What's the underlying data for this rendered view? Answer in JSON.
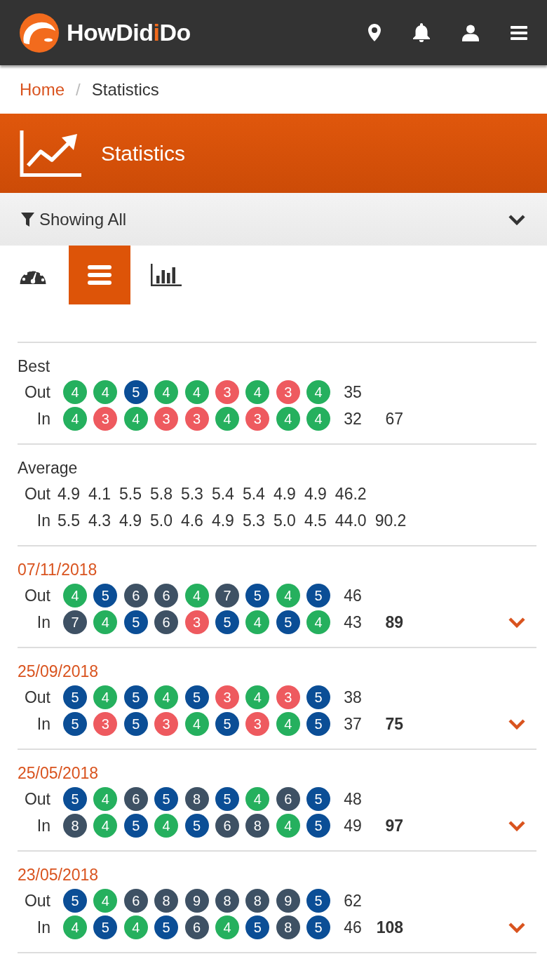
{
  "header": {
    "logo": [
      {
        "text": "HowDid",
        "accent": false
      },
      {
        "text": "i",
        "accent": true
      },
      {
        "text": "Do",
        "accent": false
      }
    ]
  },
  "breadcrumb": {
    "separator": "/",
    "items": [
      {
        "label": "Home",
        "current": false
      },
      {
        "label": "Statistics",
        "current": true
      }
    ]
  },
  "banner": {
    "title": "Statistics"
  },
  "filter": {
    "label": "Showing All",
    "expanded": false
  },
  "view_tabs": [
    {
      "kind": "gauge",
      "selected": false
    },
    {
      "kind": "list",
      "selected": true
    },
    {
      "kind": "chart",
      "selected": false
    }
  ],
  "best": {
    "title": "Best",
    "rows": [
      {
        "label": "Out",
        "holes": [
          {
            "score": "4",
            "color": "#25b05e"
          },
          {
            "score": "4",
            "color": "#25b05e"
          },
          {
            "score": "5",
            "color": "#0b4e96"
          },
          {
            "score": "4",
            "color": "#25b05e"
          },
          {
            "score": "4",
            "color": "#25b05e"
          },
          {
            "score": "3",
            "color": "#ee5a5f"
          },
          {
            "score": "4",
            "color": "#25b05e"
          },
          {
            "score": "3",
            "color": "#ee5a5f"
          },
          {
            "score": "4",
            "color": "#25b05e"
          }
        ],
        "total": "35"
      },
      {
        "label": "In",
        "holes": [
          {
            "score": "4",
            "color": "#25b05e"
          },
          {
            "score": "3",
            "color": "#ee5a5f"
          },
          {
            "score": "4",
            "color": "#25b05e"
          },
          {
            "score": "3",
            "color": "#ee5a5f"
          },
          {
            "score": "3",
            "color": "#ee5a5f"
          },
          {
            "score": "4",
            "color": "#25b05e"
          },
          {
            "score": "3",
            "color": "#ee5a5f"
          },
          {
            "score": "4",
            "color": "#25b05e"
          },
          {
            "score": "4",
            "color": "#25b05e"
          }
        ],
        "total": "32",
        "gross": "67"
      }
    ]
  },
  "average": {
    "title": "Average",
    "rows": [
      {
        "label": "Out",
        "values": [
          "4.9",
          "4.1",
          "5.5",
          "5.8",
          "5.3",
          "5.4",
          "5.4",
          "4.9",
          "4.9"
        ],
        "total": "46.2"
      },
      {
        "label": "In",
        "values": [
          "5.5",
          "4.3",
          "4.9",
          "5.0",
          "4.6",
          "4.9",
          "5.3",
          "5.0",
          "4.5"
        ],
        "total": "44.0",
        "gross": "90.2"
      }
    ]
  },
  "rounds": [
    {
      "date": "07/11/2018",
      "expanded": false,
      "rows": [
        {
          "label": "Out",
          "holes": [
            {
              "score": "4",
              "color": "#25b05e"
            },
            {
              "score": "5",
              "color": "#0b4e96"
            },
            {
              "score": "6",
              "color": "#3e5164"
            },
            {
              "score": "6",
              "color": "#3e5164"
            },
            {
              "score": "4",
              "color": "#25b05e"
            },
            {
              "score": "7",
              "color": "#3e5164"
            },
            {
              "score": "5",
              "color": "#0b4e96"
            },
            {
              "score": "4",
              "color": "#25b05e"
            },
            {
              "score": "5",
              "color": "#0b4e96"
            }
          ],
          "total": "46"
        },
        {
          "label": "In",
          "holes": [
            {
              "score": "7",
              "color": "#3e5164"
            },
            {
              "score": "4",
              "color": "#25b05e"
            },
            {
              "score": "5",
              "color": "#0b4e96"
            },
            {
              "score": "6",
              "color": "#3e5164"
            },
            {
              "score": "3",
              "color": "#ee5a5f"
            },
            {
              "score": "5",
              "color": "#0b4e96"
            },
            {
              "score": "4",
              "color": "#25b05e"
            },
            {
              "score": "5",
              "color": "#0b4e96"
            },
            {
              "score": "4",
              "color": "#25b05e"
            }
          ],
          "total": "43",
          "gross": "89"
        }
      ]
    },
    {
      "date": "25/09/2018",
      "expanded": false,
      "rows": [
        {
          "label": "Out",
          "holes": [
            {
              "score": "5",
              "color": "#0b4e96"
            },
            {
              "score": "4",
              "color": "#25b05e"
            },
            {
              "score": "5",
              "color": "#0b4e96"
            },
            {
              "score": "4",
              "color": "#25b05e"
            },
            {
              "score": "5",
              "color": "#0b4e96"
            },
            {
              "score": "3",
              "color": "#ee5a5f"
            },
            {
              "score": "4",
              "color": "#25b05e"
            },
            {
              "score": "3",
              "color": "#ee5a5f"
            },
            {
              "score": "5",
              "color": "#0b4e96"
            }
          ],
          "total": "38"
        },
        {
          "label": "In",
          "holes": [
            {
              "score": "5",
              "color": "#0b4e96"
            },
            {
              "score": "3",
              "color": "#ee5a5f"
            },
            {
              "score": "5",
              "color": "#0b4e96"
            },
            {
              "score": "3",
              "color": "#ee5a5f"
            },
            {
              "score": "4",
              "color": "#25b05e"
            },
            {
              "score": "5",
              "color": "#0b4e96"
            },
            {
              "score": "3",
              "color": "#ee5a5f"
            },
            {
              "score": "4",
              "color": "#25b05e"
            },
            {
              "score": "5",
              "color": "#0b4e96"
            }
          ],
          "total": "37",
          "gross": "75"
        }
      ]
    },
    {
      "date": "25/05/2018",
      "expanded": false,
      "rows": [
        {
          "label": "Out",
          "holes": [
            {
              "score": "5",
              "color": "#0b4e96"
            },
            {
              "score": "4",
              "color": "#25b05e"
            },
            {
              "score": "6",
              "color": "#3e5164"
            },
            {
              "score": "5",
              "color": "#0b4e96"
            },
            {
              "score": "8",
              "color": "#3e5164"
            },
            {
              "score": "5",
              "color": "#0b4e96"
            },
            {
              "score": "4",
              "color": "#25b05e"
            },
            {
              "score": "6",
              "color": "#3e5164"
            },
            {
              "score": "5",
              "color": "#0b4e96"
            }
          ],
          "total": "48"
        },
        {
          "label": "In",
          "holes": [
            {
              "score": "8",
              "color": "#3e5164"
            },
            {
              "score": "4",
              "color": "#25b05e"
            },
            {
              "score": "5",
              "color": "#0b4e96"
            },
            {
              "score": "4",
              "color": "#25b05e"
            },
            {
              "score": "5",
              "color": "#0b4e96"
            },
            {
              "score": "6",
              "color": "#3e5164"
            },
            {
              "score": "8",
              "color": "#3e5164"
            },
            {
              "score": "4",
              "color": "#25b05e"
            },
            {
              "score": "5",
              "color": "#0b4e96"
            }
          ],
          "total": "49",
          "gross": "97"
        }
      ]
    },
    {
      "date": "23/05/2018",
      "expanded": false,
      "rows": [
        {
          "label": "Out",
          "holes": [
            {
              "score": "5",
              "color": "#0b4e96"
            },
            {
              "score": "4",
              "color": "#25b05e"
            },
            {
              "score": "6",
              "color": "#3e5164"
            },
            {
              "score": "8",
              "color": "#3e5164"
            },
            {
              "score": "9",
              "color": "#3e5164"
            },
            {
              "score": "8",
              "color": "#3e5164"
            },
            {
              "score": "8",
              "color": "#3e5164"
            },
            {
              "score": "9",
              "color": "#3e5164"
            },
            {
              "score": "5",
              "color": "#0b4e96"
            }
          ],
          "total": "62"
        },
        {
          "label": "In",
          "holes": [
            {
              "score": "4",
              "color": "#25b05e"
            },
            {
              "score": "5",
              "color": "#0b4e96"
            },
            {
              "score": "4",
              "color": "#25b05e"
            },
            {
              "score": "5",
              "color": "#0b4e96"
            },
            {
              "score": "6",
              "color": "#3e5164"
            },
            {
              "score": "4",
              "color": "#25b05e"
            },
            {
              "score": "5",
              "color": "#0b4e96"
            },
            {
              "score": "8",
              "color": "#3e5164"
            },
            {
              "score": "5",
              "color": "#0b4e96"
            }
          ],
          "total": "46",
          "gross": "108"
        }
      ]
    }
  ]
}
